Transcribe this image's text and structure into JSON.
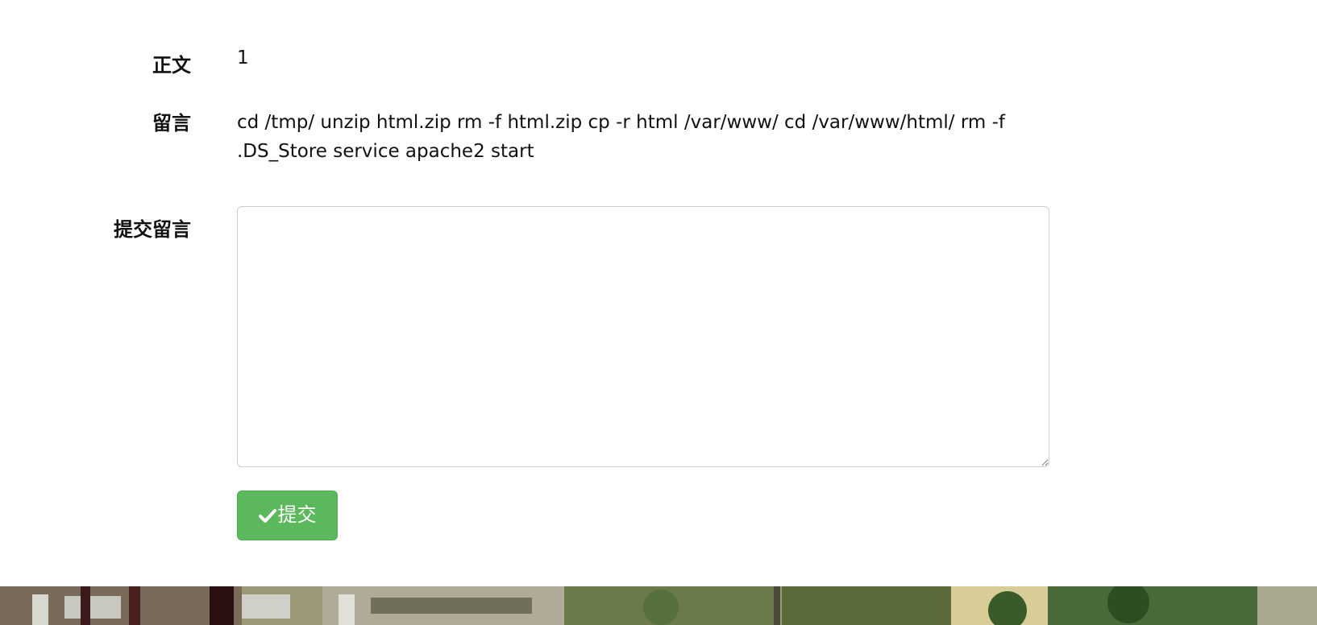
{
  "form": {
    "body_label": "正文",
    "body_value": "1",
    "message_label": "留言",
    "message_value": "cd /tmp/ unzip html.zip rm -f html.zip cp -r html /var/www/ cd /var/www/html/ rm -f .DS_Store service apache2 start",
    "submit_label": "提交留言",
    "comment_value": "",
    "submit_button_label": "提交"
  },
  "icons": {
    "submit_icon": "check-icon"
  },
  "colors": {
    "submit_button": "#5cb85c",
    "submit_button_text": "#ffffff",
    "textarea_border": "#cfcfcf"
  }
}
